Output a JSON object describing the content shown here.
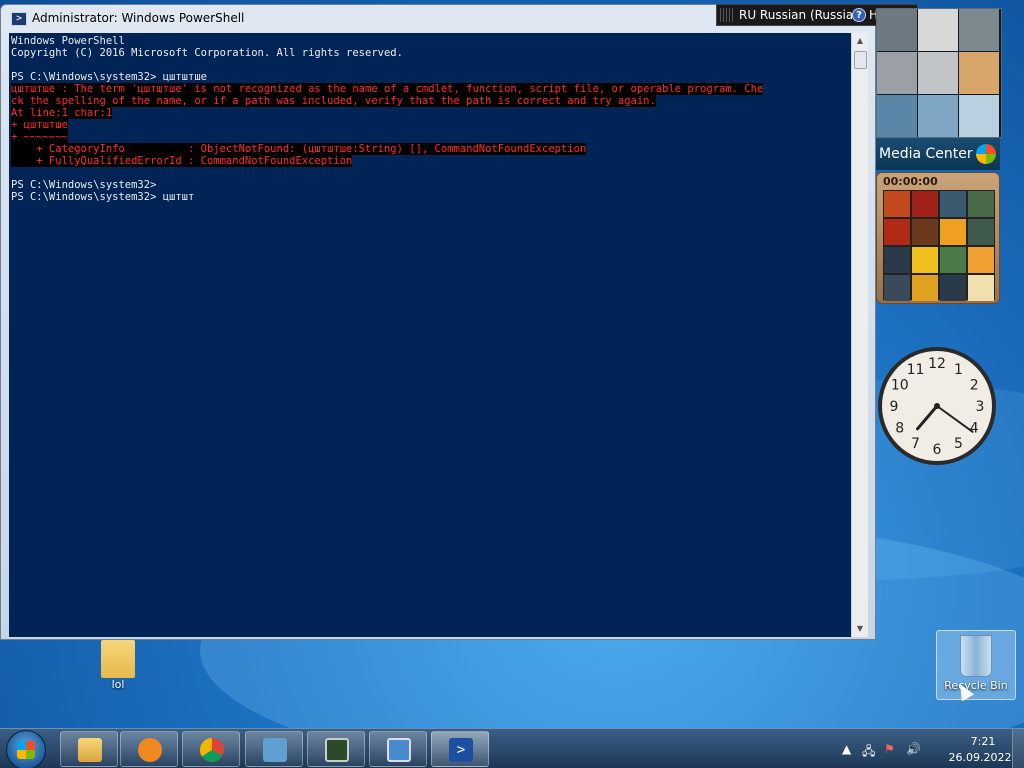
{
  "window": {
    "title": "Administrator: Windows PowerShell",
    "icon": "powershell-icon"
  },
  "console": {
    "lines": [
      {
        "text": "Windows PowerShell",
        "error": false
      },
      {
        "text": "Copyright (C) 2016 Microsoft Corporation. All rights reserved.",
        "error": false
      },
      {
        "text": "",
        "error": false
      },
      {
        "text": "PS C:\\Windows\\system32> цштштше",
        "error": false
      },
      {
        "text": "цштштше : The term 'цштштше' is not recognized as the name of a cmdlet, function, script file, or operable program. Che",
        "error": true
      },
      {
        "text": "ck the spelling of the name, or if a path was included, verify that the path is correct and try again.",
        "error": true
      },
      {
        "text": "At line:1 char:1",
        "error": true
      },
      {
        "text": "+ цштштше",
        "error": true
      },
      {
        "text": "+ ~~~~~~~",
        "error": true
      },
      {
        "text": "    + CategoryInfo          : ObjectNotFound: (цштштше:String) [], CommandNotFoundException",
        "error": true
      },
      {
        "text": "    + FullyQualifiedErrorId : CommandNotFoundException",
        "error": true
      },
      {
        "text": "",
        "error": false
      },
      {
        "text": "PS C:\\Windows\\system32>",
        "error": false
      },
      {
        "text": "PS C:\\Windows\\system32> цштшт",
        "error": false
      }
    ],
    "colors": {
      "background": "#012456",
      "text": "#eeedf0",
      "error": "#ff2a2a"
    }
  },
  "language_bar": {
    "language": "RU Russian (Russia)",
    "help": "Help"
  },
  "gadgets": {
    "media_center": "Media Center",
    "puzzle_timer": "00:00:00",
    "clock": {
      "numbers": [
        "12",
        "1",
        "2",
        "3",
        "4",
        "5",
        "6",
        "7",
        "8",
        "9",
        "10",
        "11"
      ],
      "time": "7:21"
    }
  },
  "desktop_icons": [
    {
      "label": "lol",
      "icon": "folder-icon"
    },
    {
      "label": "Recycle Bin",
      "icon": "recycle-bin-icon"
    }
  ],
  "taskbar": {
    "pinned": [
      {
        "name": "explorer",
        "icon": "folder-icon"
      },
      {
        "name": "media-player",
        "icon": "media-player-icon"
      },
      {
        "name": "chrome",
        "icon": "chrome-icon"
      },
      {
        "name": "control-panel",
        "icon": "control-panel-icon"
      },
      {
        "name": "task-manager",
        "icon": "monitor-icon"
      },
      {
        "name": "remote-desktop",
        "icon": "remote-desktop-icon"
      },
      {
        "name": "powershell",
        "icon": "powershell-icon"
      }
    ],
    "tray": {
      "time": "7:21",
      "date": "26.09.2022"
    }
  }
}
